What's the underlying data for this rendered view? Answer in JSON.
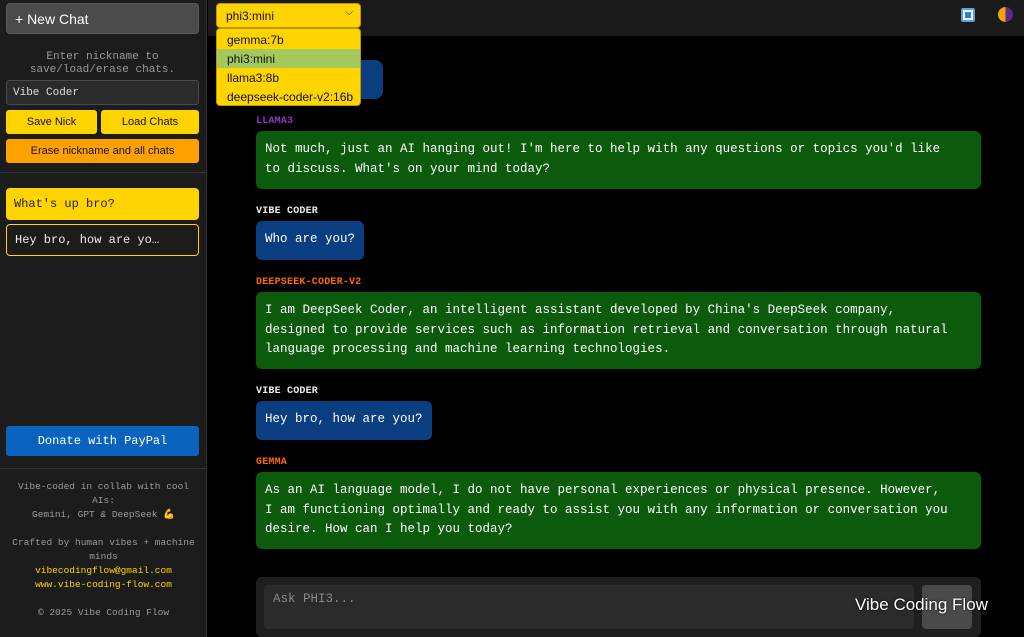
{
  "sidebar": {
    "new_chat_label": "+ New Chat",
    "hint": "Enter nickname to save/load/erase chats.",
    "nickname_value": "Vibe Coder",
    "save_nick_label": "Save Nick",
    "load_chats_label": "Load Chats",
    "erase_label": "Erase nickname and all chats",
    "chats": [
      "What's up bro?",
      "Hey bro, how are yo…"
    ],
    "donate_label": "Donate with PayPal",
    "footer": {
      "line1": "Vibe-coded in collab with cool AIs:",
      "line2": "Gemini, GPT & DeepSeek 💪",
      "line3": "Crafted by human vibes + machine minds",
      "email": "vibecodingflow@gmail.com",
      "site": "www.vibe-coding-flow.com",
      "copyright": "© 2025 Vibe Coding Flow"
    }
  },
  "topbar": {
    "selected_model": "phi3:mini",
    "model_options": [
      "gemma:7b",
      "phi3:mini",
      "llama3:8b",
      "deepseek-coder-v2:16b"
    ]
  },
  "messages": [
    {
      "role": "user",
      "text": "p?"
    },
    {
      "role": "bot",
      "sender": "LLAMA3",
      "sender_color": "#9b2fc9",
      "text": "Not much, just an AI hanging out! I'm here to help with any questions or topics you'd like\nto discuss. What's on your mind today?"
    },
    {
      "role": "user",
      "sender": "VIBE CODER",
      "text": "Who are you?"
    },
    {
      "role": "bot",
      "sender": "DEEPSEEK-CODER-V2",
      "sender_color": "#ff6a00",
      "text": "I am DeepSeek Coder, an intelligent assistant developed by China's DeepSeek company,\ndesigned to provide services such as information retrieval and conversation through natural\nlanguage processing and machine learning technologies."
    },
    {
      "role": "user",
      "sender": "VIBE CODER",
      "text": "Hey bro, how are you?"
    },
    {
      "role": "bot",
      "sender": "GEMMA",
      "sender_color": "#ff6a00",
      "text": "As an AI language model, I do not have personal experiences or physical presence. However,\nI am functioning optimally and ready to assist you with any information or conversation you\ndesire. How can I help you today?"
    }
  ],
  "input": {
    "placeholder": "Ask PHI3..."
  },
  "watermark": "Vibe Coding Flow",
  "colors": {
    "accent_yellow": "#ffd400",
    "accent_orange": "#ffa200",
    "bot_bubble": "#0c5a0c",
    "user_bubble": "#0b3e80",
    "paypal_blue": "#0a64bf"
  }
}
